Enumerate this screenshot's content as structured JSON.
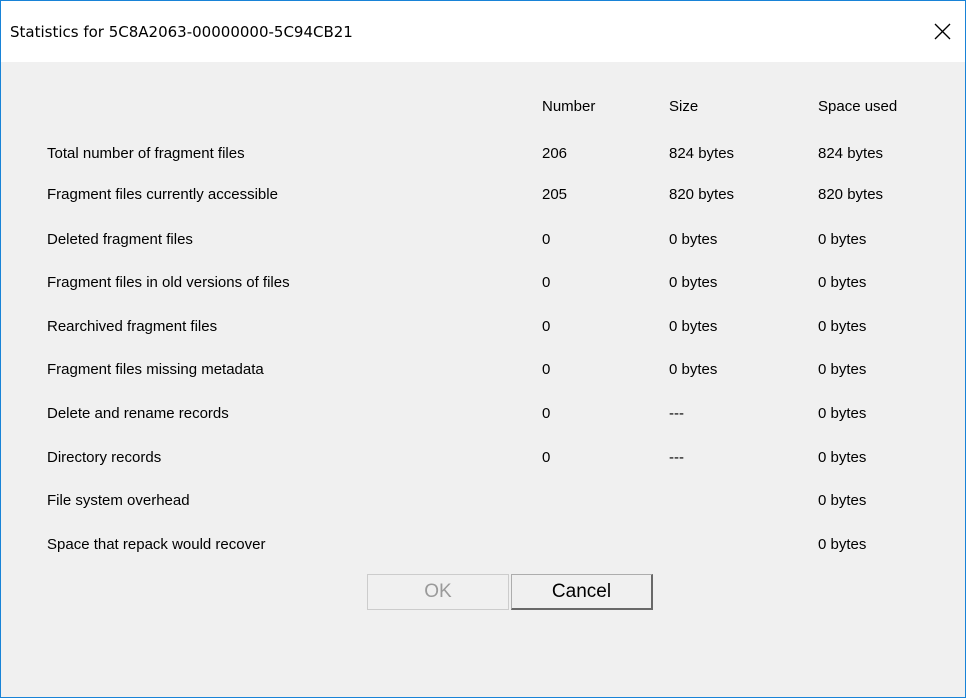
{
  "window": {
    "title": "Statistics for 5C8A2063-00000000-5C94CB21",
    "close_icon": "close-x-icon"
  },
  "table": {
    "headers": {
      "number": "Number",
      "size": "Size",
      "space_used": "Space used"
    },
    "rows": [
      {
        "label": "Total number of fragment files",
        "number": "206",
        "size": "824 bytes",
        "space_used": "824 bytes"
      },
      {
        "label": "Fragment files currently accessible",
        "number": "205",
        "size": "820 bytes",
        "space_used": "820 bytes"
      },
      {
        "label": "Deleted fragment files",
        "number": "0",
        "size": "0 bytes",
        "space_used": "0 bytes"
      },
      {
        "label": "Fragment files in old versions of files",
        "number": "0",
        "size": "0 bytes",
        "space_used": "0 bytes"
      },
      {
        "label": "Rearchived fragment files",
        "number": "0",
        "size": "0 bytes",
        "space_used": "0 bytes"
      },
      {
        "label": "Fragment files missing metadata",
        "number": "0",
        "size": "0 bytes",
        "space_used": "0 bytes"
      },
      {
        "label": "Delete and rename records",
        "number": "0",
        "size": "---",
        "space_used": "0 bytes"
      },
      {
        "label": "Directory records",
        "number": "0",
        "size": "---",
        "space_used": "0 bytes"
      },
      {
        "label": "File system overhead",
        "number": "",
        "size": "",
        "space_used": "0 bytes"
      },
      {
        "label": "Space that repack would recover",
        "number": "",
        "size": "",
        "space_used": "0 bytes"
      }
    ]
  },
  "buttons": {
    "ok_label": "OK",
    "ok_disabled": true,
    "cancel_label": "Cancel"
  }
}
